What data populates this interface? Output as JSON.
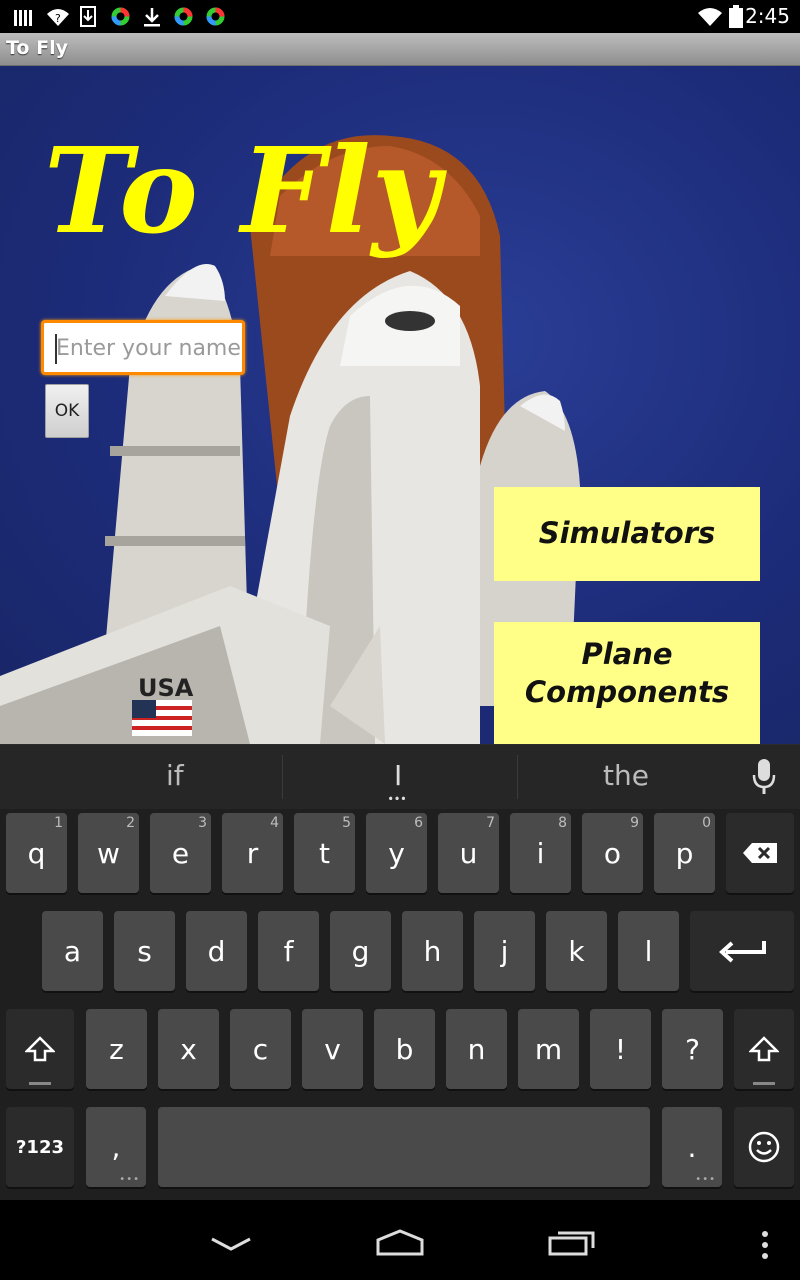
{
  "status_bar": {
    "time": "2:45"
  },
  "title_bar": {
    "title": "To Fly"
  },
  "main": {
    "app_title": "To Fly",
    "name_input": {
      "placeholder": "Enter your name",
      "value": ""
    },
    "ok_label": "OK",
    "buttons": {
      "simulators": "Simulators",
      "plane_components": "Plane\nComponents"
    },
    "shuttle_label": "USA"
  },
  "keyboard": {
    "suggestions": [
      "if",
      "I",
      "the"
    ],
    "row1": [
      {
        "k": "q",
        "h": "1"
      },
      {
        "k": "w",
        "h": "2"
      },
      {
        "k": "e",
        "h": "3"
      },
      {
        "k": "r",
        "h": "4"
      },
      {
        "k": "t",
        "h": "5"
      },
      {
        "k": "y",
        "h": "6"
      },
      {
        "k": "u",
        "h": "7"
      },
      {
        "k": "i",
        "h": "8"
      },
      {
        "k": "o",
        "h": "9"
      },
      {
        "k": "p",
        "h": "0"
      }
    ],
    "row2": [
      "a",
      "s",
      "d",
      "f",
      "g",
      "h",
      "j",
      "k",
      "l"
    ],
    "row3": [
      "z",
      "x",
      "c",
      "v",
      "b",
      "n",
      "m",
      "!",
      "?"
    ],
    "symbols_label": "?123",
    "comma_label": ",",
    "period_label": "."
  },
  "colors": {
    "accent_yellow": "#ffff00",
    "button_yellow": "#ffff88",
    "focus_orange": "#ff8a00",
    "sky": "#1d2c7a"
  }
}
